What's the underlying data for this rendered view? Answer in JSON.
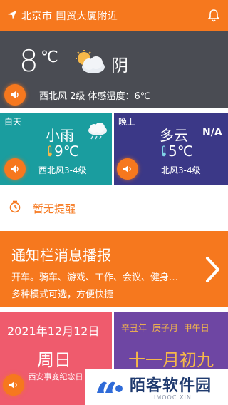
{
  "topbar": {
    "location": "北京市 国贸大厦附近",
    "location_icon": "location-arrow-icon",
    "bell_icon": "bell-icon"
  },
  "current": {
    "temp": "8",
    "unit": "℃",
    "weather_icon": "partly-cloudy-icon",
    "condition": "阴",
    "details": "西北风 2级   体感温度：6℃"
  },
  "day": {
    "tag": "白天",
    "condition": "小雨",
    "weather_icon": "light-rain-icon",
    "temp": "9℃",
    "wind": "西北风3-4级"
  },
  "night": {
    "tag": "晚上",
    "condition": "多云",
    "aqi": "N/A",
    "temp": "5℃",
    "wind": "北风3-4级"
  },
  "reminder": {
    "text": "暂无提醒",
    "icon": "alarm-clock-icon"
  },
  "notice": {
    "title": "通知栏消息播报",
    "line1": "开车。骑车、游戏、工作、会议、健身…",
    "line2": "多种模式可选，方便快捷"
  },
  "calendar": {
    "date": "2021年12月12日",
    "weekday": "周日",
    "holiday": "西安事变纪念日"
  },
  "lunar": {
    "ganzhi": "辛丑年 庚子月 甲午日",
    "date": "十一月初九"
  },
  "watermark": {
    "title": "陌客软件园",
    "subtitle": "IMOOC.XIN"
  },
  "colors": {
    "accent": "#f6781e",
    "dark": "#4a4c53",
    "teal": "#1a9d9f",
    "indigo": "#3b3887",
    "red": "#ef5b6d",
    "purple": "#6e46a3",
    "gold": "#f6b84a"
  }
}
